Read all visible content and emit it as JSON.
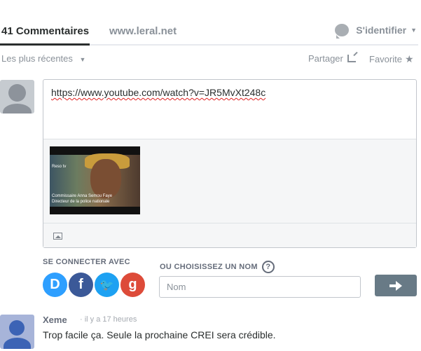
{
  "header": {
    "comment_count_tab": "41 Commentaires",
    "site_tab": "www.leral.net",
    "login_label": "S'identifier"
  },
  "sortbar": {
    "sort_label": "Les plus récentes",
    "share_label": "Partager",
    "favorite_label": "Favorite"
  },
  "composer": {
    "text": "https://www.youtube.com/watch?v=JR5MvXt248c",
    "video_caption_line1": "Commissaire Anna Semou Faye",
    "video_caption_line2": "Directeur de la police nationale",
    "video_logo": "Reso tv"
  },
  "auth": {
    "connect_label": "SE CONNECTER AVEC",
    "choose_name_label": "OU CHOISISSEZ UN NOM",
    "help_glyph": "?",
    "name_placeholder": "Nom",
    "social": [
      {
        "name": "disqus",
        "glyph": "D"
      },
      {
        "name": "facebook",
        "glyph": "f"
      },
      {
        "name": "twitter",
        "glyph": "🐦"
      },
      {
        "name": "google",
        "glyph": "g"
      }
    ]
  },
  "comment": {
    "author": "Xeme",
    "time": "· il y a 17 heures",
    "text": "Trop facile ça. Seule la prochaine CREI sera crédible."
  },
  "colors": {
    "accent": "#2e9fff",
    "submit": "#687a86"
  }
}
